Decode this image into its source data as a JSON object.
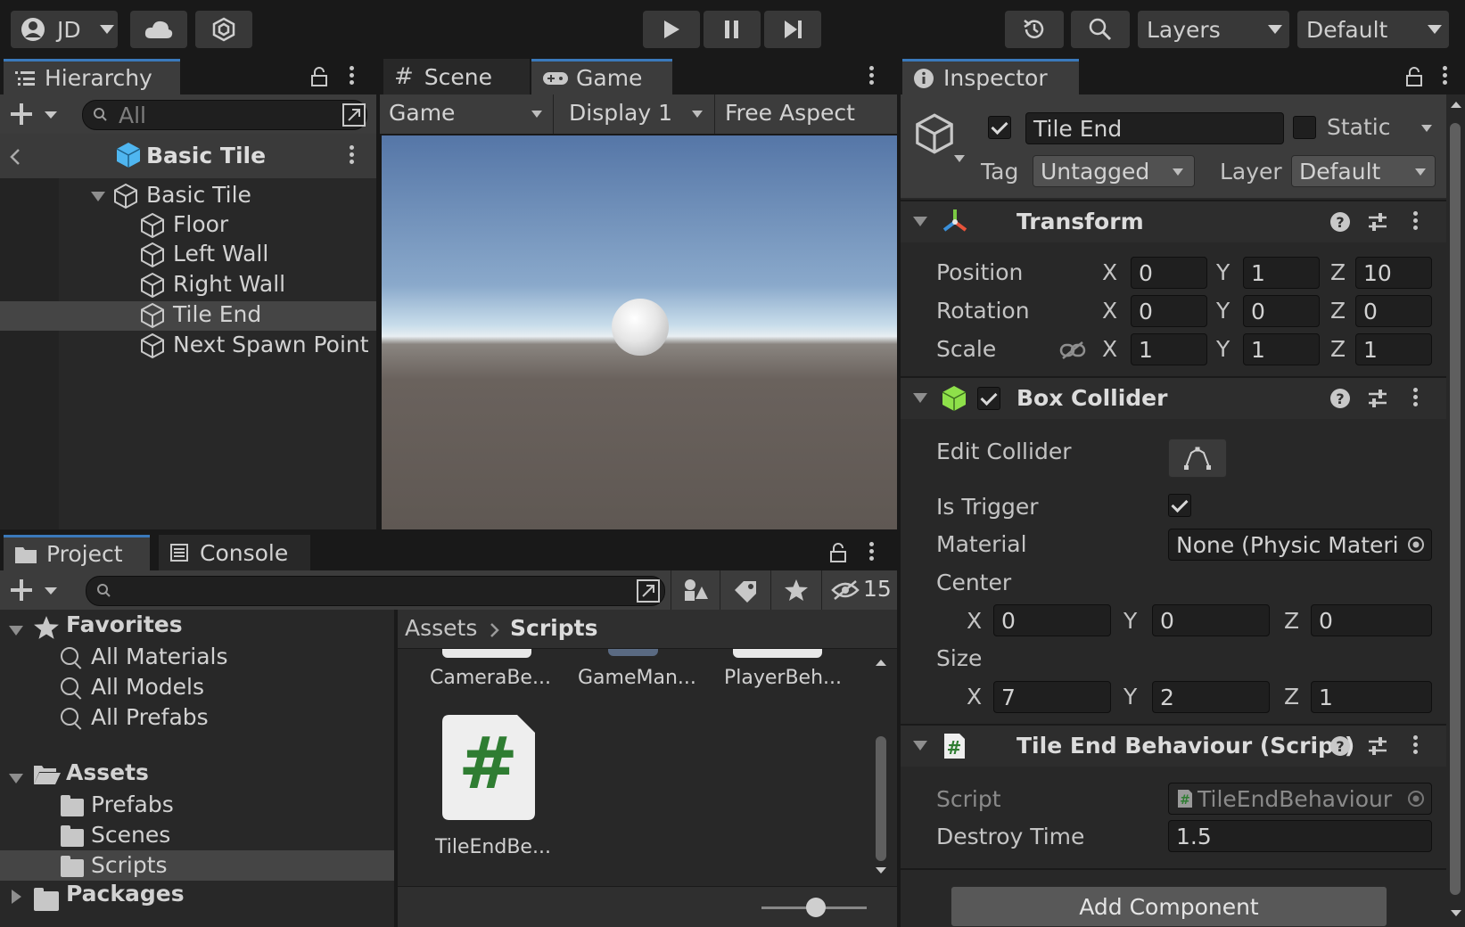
{
  "toolbar": {
    "account": "JD",
    "layers_label": "Layers",
    "layout_label": "Default"
  },
  "hierarchy": {
    "tab": "Hierarchy",
    "search_placeholder": "All",
    "prefab_title": "Basic Tile",
    "items": [
      {
        "label": "Basic Tile"
      },
      {
        "label": "Floor"
      },
      {
        "label": "Left Wall"
      },
      {
        "label": "Right Wall"
      },
      {
        "label": "Tile End"
      },
      {
        "label": "Next Spawn Point"
      }
    ]
  },
  "game": {
    "tab_scene": "Scene",
    "tab_game": "Game",
    "mode": "Game",
    "display": "Display 1",
    "aspect": "Free Aspect"
  },
  "project": {
    "tab_project": "Project",
    "tab_console": "Console",
    "hidden_count": "15",
    "favorites": {
      "label": "Favorites",
      "items": [
        "All Materials",
        "All Models",
        "All Prefabs"
      ]
    },
    "assets": {
      "label": "Assets",
      "items": [
        "Prefabs",
        "Scenes",
        "Scripts"
      ]
    },
    "packages": "Packages",
    "breadcrumb": {
      "root": "Assets",
      "current": "Scripts"
    },
    "files_top": [
      "CameraBe...",
      "GameMan...",
      "PlayerBeh..."
    ],
    "file_main": "TileEndBe...",
    "hash": "#"
  },
  "inspector": {
    "tab": "Inspector",
    "object_name": "Tile End",
    "static_label": "Static",
    "tag_label": "Tag",
    "tag_value": "Untagged",
    "layer_label": "Layer",
    "layer_value": "Default",
    "transform": {
      "title": "Transform",
      "position_label": "Position",
      "rotation_label": "Rotation",
      "scale_label": "Scale",
      "position": {
        "x": "0",
        "y": "1",
        "z": "10"
      },
      "rotation": {
        "x": "0",
        "y": "0",
        "z": "0"
      },
      "scale": {
        "x": "1",
        "y": "1",
        "z": "1"
      }
    },
    "box_collider": {
      "title": "Box Collider",
      "edit_collider": "Edit Collider",
      "is_trigger": "Is Trigger",
      "material_label": "Material",
      "material_value": "None (Physic Materi",
      "center_label": "Center",
      "size_label": "Size",
      "center": {
        "x": "0",
        "y": "0",
        "z": "0"
      },
      "size": {
        "x": "7",
        "y": "2",
        "z": "1"
      }
    },
    "script": {
      "title": "Tile End Behaviour (Script)",
      "script_label": "Script",
      "script_value": "TileEndBehaviour",
      "destroy_label": "Destroy Time",
      "destroy_value": "1.5"
    },
    "add_component": "Add Component",
    "axis": {
      "x": "X",
      "y": "Y",
      "z": "Z"
    }
  },
  "colors": {
    "accent": "#3a79bb",
    "panel": "#282828",
    "toolbar": "#191919"
  }
}
